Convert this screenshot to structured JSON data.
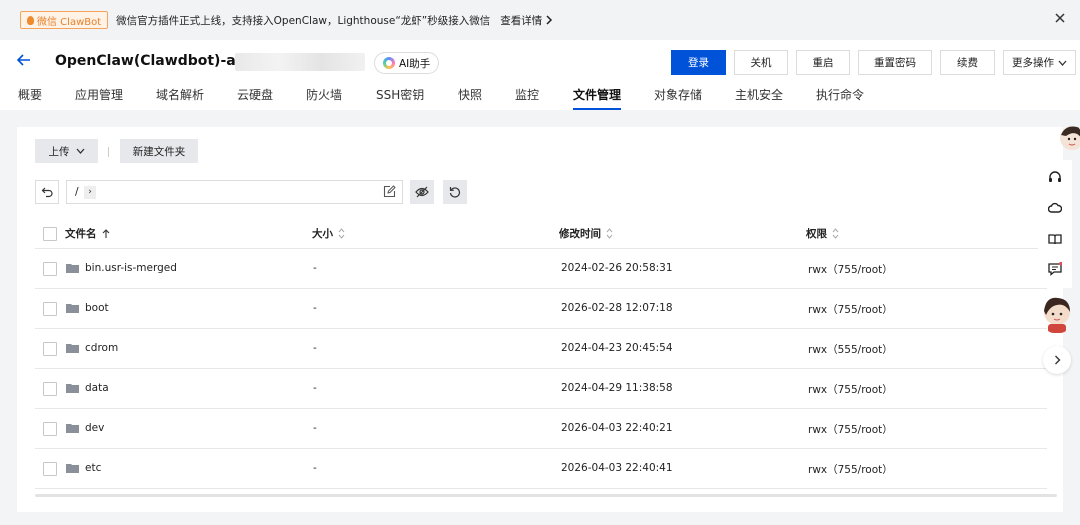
{
  "notice": {
    "badge": "微信 ClawBot",
    "text": "微信官方插件正式上线，支持接入OpenClaw，Lighthouse“龙虾”秒级接入微信",
    "link": "查看详情",
    "link_icon": "chevron-right-icon",
    "close_icon": "close-icon"
  },
  "header": {
    "back_icon": "back-arrow-icon",
    "title": "OpenClaw(Clawdbot)-ahXv",
    "ai_button": "AI助手",
    "actions": [
      "登录",
      "关机",
      "重启",
      "重置密码",
      "续费",
      "更多操作"
    ],
    "primary_color": "#0052d9"
  },
  "tabs": [
    "概要",
    "应用管理",
    "域名解析",
    "云硬盘",
    "防火墙",
    "SSH密钥",
    "快照",
    "监控",
    "文件管理",
    "对象存储",
    "主机安全",
    "执行命令"
  ],
  "active_tab": "文件管理",
  "toolbar": {
    "upload": "上传",
    "new_folder": "新建文件夹"
  },
  "path": {
    "root": "/",
    "chevron": "›"
  },
  "table": {
    "columns": {
      "name": "文件名",
      "size": "大小",
      "mtime": "修改时间",
      "perm": "权限"
    },
    "rows": [
      {
        "name": "bin.usr-is-merged",
        "size": "-",
        "mtime": "2024-02-26 20:58:31",
        "perm": "rwx（755/root）"
      },
      {
        "name": "boot",
        "size": "-",
        "mtime": "2026-02-28 12:07:18",
        "perm": "rwx（755/root）"
      },
      {
        "name": "cdrom",
        "size": "-",
        "mtime": "2024-04-23 20:45:54",
        "perm": "rwx（555/root）"
      },
      {
        "name": "data",
        "size": "-",
        "mtime": "2024-04-29 11:38:58",
        "perm": "rwx（755/root）"
      },
      {
        "name": "dev",
        "size": "-",
        "mtime": "2026-04-03 22:40:21",
        "perm": "rwx（755/root）"
      },
      {
        "name": "etc",
        "size": "-",
        "mtime": "2026-04-03 22:40:41",
        "perm": "rwx（755/root）"
      }
    ]
  },
  "side_toolbar": {
    "icons": [
      "headset-icon",
      "cloud-icon",
      "book-icon",
      "message-icon"
    ],
    "expand_icon": "chevron-right-icon"
  }
}
